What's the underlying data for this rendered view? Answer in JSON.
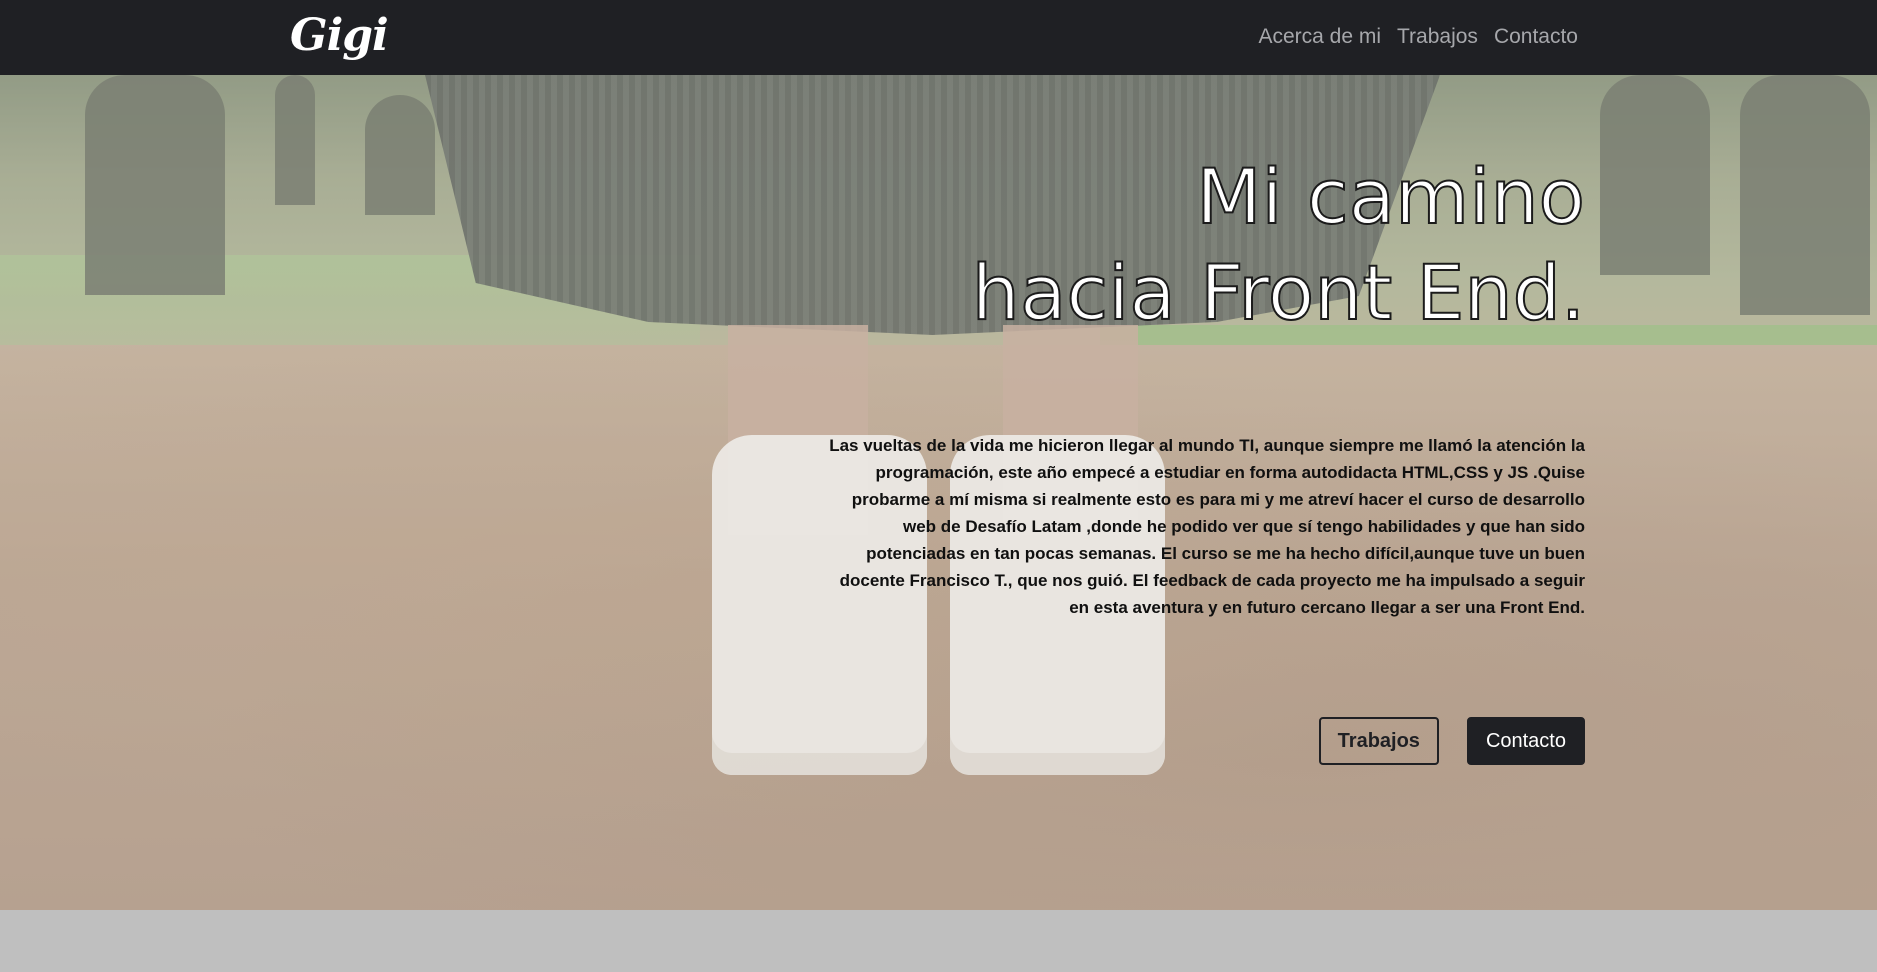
{
  "navbar": {
    "brand": "Gigi",
    "links": [
      "Acerca de mi",
      "Trabajos",
      "Contacto"
    ]
  },
  "hero": {
    "title_line1": "Mi camino",
    "title_line2": "hacia Front End.",
    "description": "Las vueltas de la vida me hicieron llegar al mundo TI, aunque siempre me llamó la atención la programación, este año empecé a estudiar en forma autodidacta HTML,CSS y JS .Quise probarme a mí misma si realmente esto es para mi y me atreví hacer el curso de desarrollo web de Desafío Latam ,donde he podido ver que sí tengo habilidades y que han sido potenciadas en tan pocas semanas. El curso se me ha hecho difícil,aunque tuve un buen docente Francisco T., que nos guió. El feedback de cada proyecto me ha impulsado a seguir en esta aventura y en futuro cercano llegar a ser una Front End.",
    "buttons": {
      "works": "Trabajos",
      "contact": "Contacto"
    }
  },
  "colors": {
    "navbar_bg": "#1f2024",
    "nav_link": "#a6a7ab",
    "button_dark": "#1f2024"
  }
}
